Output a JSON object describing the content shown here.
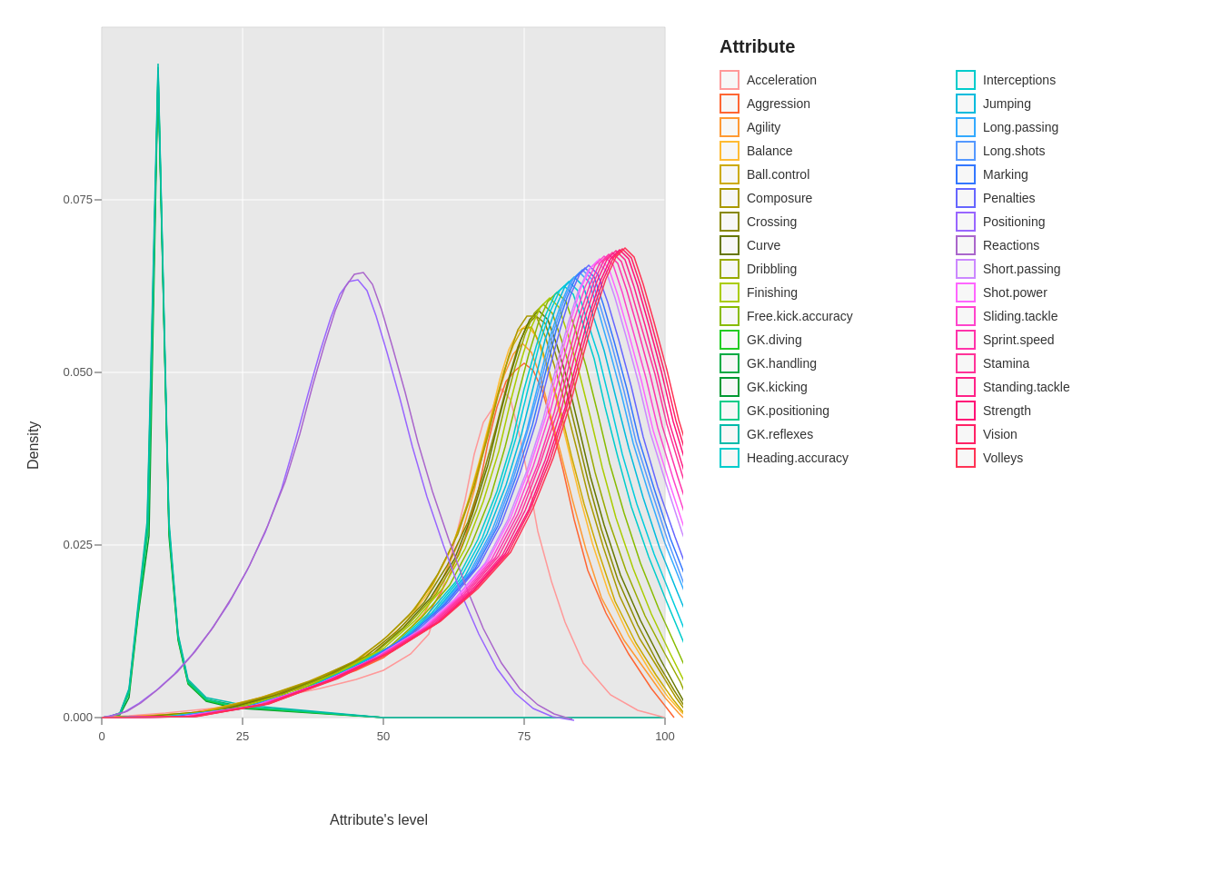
{
  "chart": {
    "title": "",
    "y_axis_label": "Density",
    "x_axis_label": "Attribute's level",
    "x_ticks": [
      "0",
      "25",
      "50",
      "75",
      "100"
    ],
    "y_ticks": [
      "0.000",
      "0.025",
      "0.050",
      "0.075"
    ],
    "plot_bg": "#e8e8e8"
  },
  "legend": {
    "title": "Attribute",
    "items_col1": [
      {
        "label": "Acceleration",
        "color": "#FF9999"
      },
      {
        "label": "Aggression",
        "color": "#FF6633"
      },
      {
        "label": "Agility",
        "color": "#FF9933"
      },
      {
        "label": "Balance",
        "color": "#FFBB33"
      },
      {
        "label": "Ball.control",
        "color": "#CCAA00"
      },
      {
        "label": "Composure",
        "color": "#AA9900"
      },
      {
        "label": "Crossing",
        "color": "#888800"
      },
      {
        "label": "Curve",
        "color": "#667700"
      },
      {
        "label": "Dribbling",
        "color": "#99AA00"
      },
      {
        "label": "Finishing",
        "color": "#AACC00"
      },
      {
        "label": "Free.kick.accuracy",
        "color": "#88BB00"
      },
      {
        "label": "GK.diving",
        "color": "#22CC22"
      },
      {
        "label": "GK.handling",
        "color": "#00AA44"
      },
      {
        "label": "GK.kicking",
        "color": "#009933"
      },
      {
        "label": "GK.positioning",
        "color": "#00CC88"
      },
      {
        "label": "GK.reflexes",
        "color": "#00BBAA"
      },
      {
        "label": "Heading.accuracy",
        "color": "#00CCCC"
      }
    ],
    "items_col2": [
      {
        "label": "Interceptions",
        "color": "#00CCCC"
      },
      {
        "label": "Jumping",
        "color": "#00BBDD"
      },
      {
        "label": "Long.passing",
        "color": "#33AAFF"
      },
      {
        "label": "Long.shots",
        "color": "#5599FF"
      },
      {
        "label": "Marking",
        "color": "#3377FF"
      },
      {
        "label": "Penalties",
        "color": "#6666FF"
      },
      {
        "label": "Positioning",
        "color": "#9966FF"
      },
      {
        "label": "Reactions",
        "color": "#AA66CC"
      },
      {
        "label": "Short.passing",
        "color": "#CC88FF"
      },
      {
        "label": "Shot.power",
        "color": "#FF66FF"
      },
      {
        "label": "Sliding.tackle",
        "color": "#FF44CC"
      },
      {
        "label": "Sprint.speed",
        "color": "#FF33AA"
      },
      {
        "label": "Stamina",
        "color": "#FF3399"
      },
      {
        "label": "Standing.tackle",
        "color": "#FF2288"
      },
      {
        "label": "Strength",
        "color": "#FF1177"
      },
      {
        "label": "Vision",
        "color": "#FF2266"
      },
      {
        "label": "Volleys",
        "color": "#FF3355"
      }
    ]
  }
}
